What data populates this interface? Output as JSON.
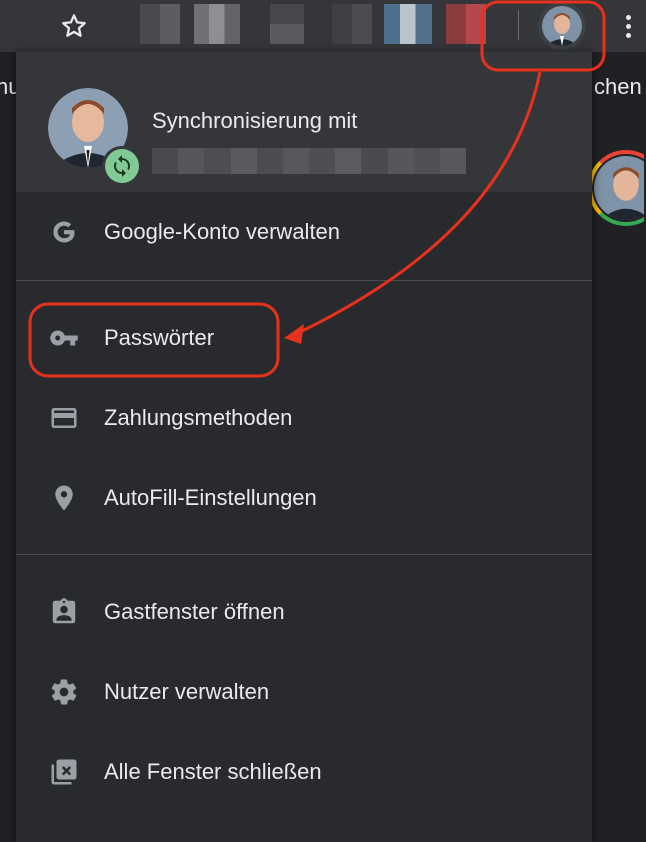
{
  "toolbar": {
    "bookmark_icon": "star-outline-icon",
    "menu_icon": "three-dots-vertical-icon",
    "avatar_icon": "profile-avatar-icon"
  },
  "background": {
    "left_fragment": "nu",
    "right_fragment": "chen"
  },
  "profile_menu": {
    "sync_title": "Synchronisierung mit",
    "sync_badge_icon": "sync-icon",
    "items": [
      {
        "label": "Google-Konto verwalten",
        "icon": "google-g-icon"
      },
      {
        "label": "Passwörter",
        "icon": "key-icon",
        "highlighted": true
      },
      {
        "label": "Zahlungsmethoden",
        "icon": "credit-card-icon"
      },
      {
        "label": "AutoFill-Einstellungen",
        "icon": "location-pin-icon"
      },
      {
        "label": "Gastfenster öffnen",
        "icon": "guest-badge-icon"
      },
      {
        "label": "Nutzer verwalten",
        "icon": "gear-icon"
      },
      {
        "label": "Alle Fenster schließen",
        "icon": "close-windows-icon"
      }
    ]
  },
  "colors": {
    "panel": "#292a2d",
    "header": "#35363a",
    "text": "#e8eaed",
    "icon": "#9aa0a6",
    "annotation": "#e8311d",
    "sync_badge": "#81c995"
  }
}
